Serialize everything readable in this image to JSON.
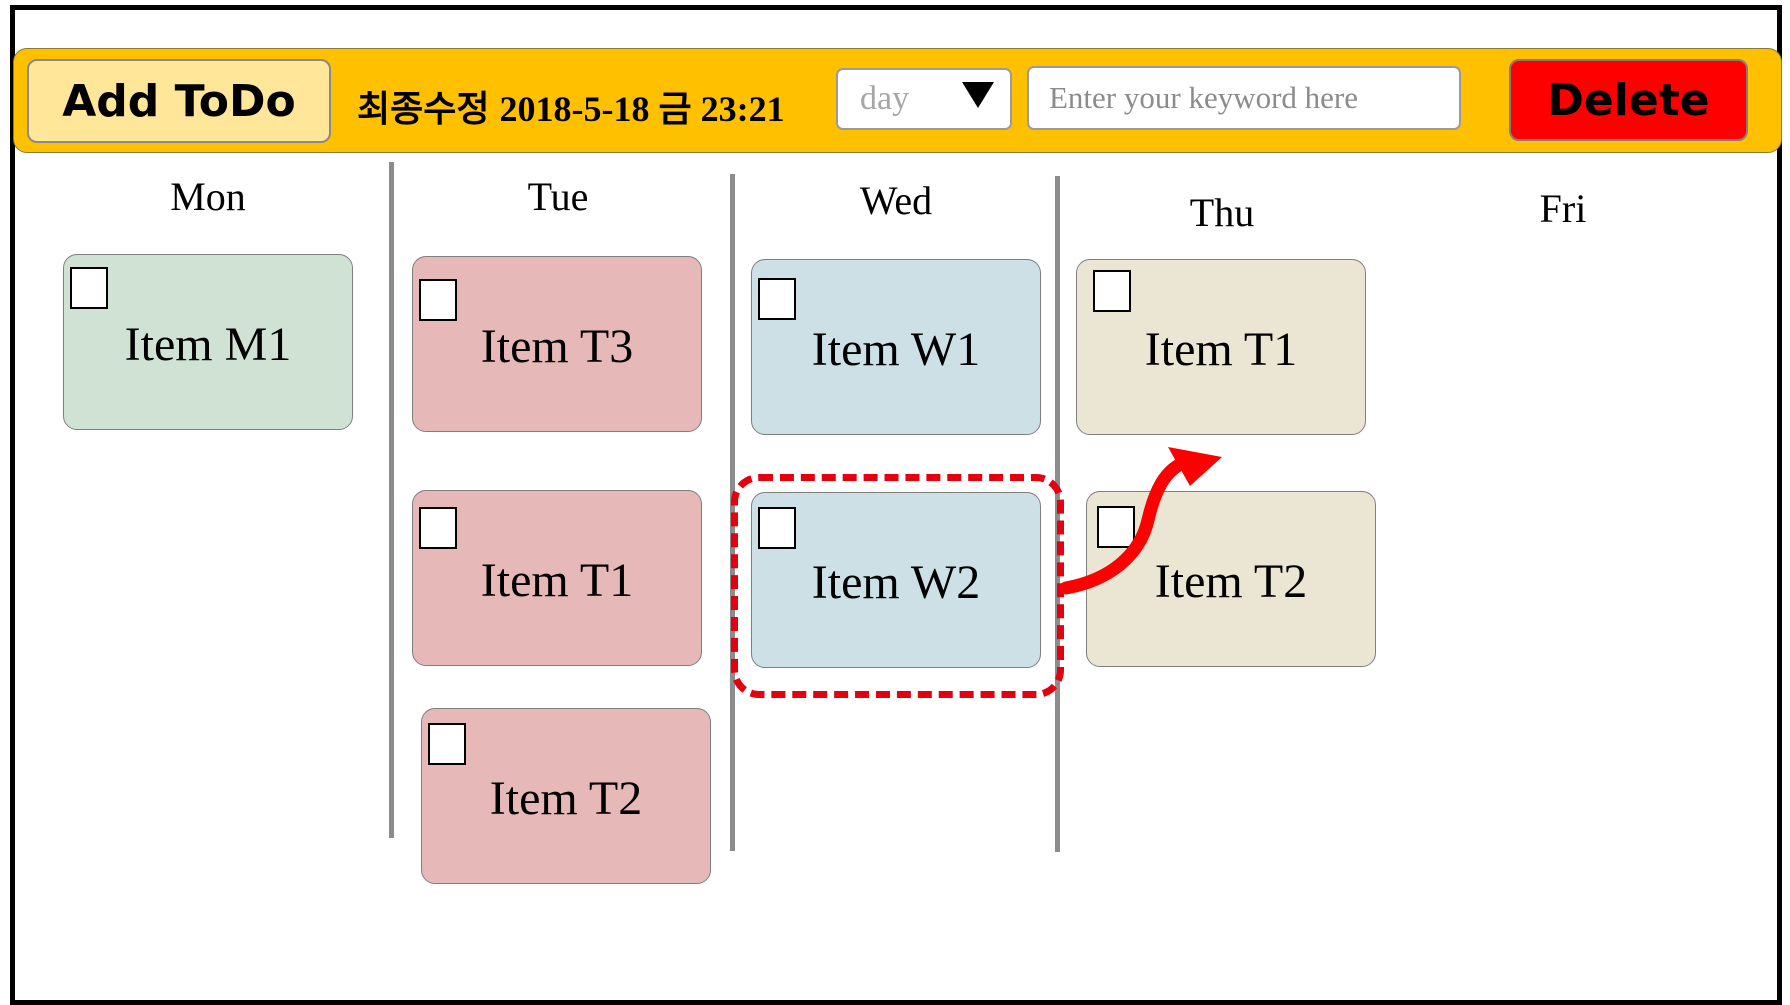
{
  "toolbar": {
    "add_label": "Add ToDo",
    "last_modified_label": "최종수정",
    "last_modified_value": "2018-5-18 금 23:21",
    "view_select_value": "day",
    "search_placeholder": "Enter your keyword here",
    "delete_label": "Delete"
  },
  "days": [
    "Mon",
    "Tue",
    "Wed",
    "Thu",
    "Fri"
  ],
  "cards": {
    "mon": [
      {
        "title": "Item M1"
      }
    ],
    "tue": [
      {
        "title": "Item T3"
      },
      {
        "title": "Item T1"
      },
      {
        "title": "Item T2"
      }
    ],
    "wed": [
      {
        "title": "Item W1"
      },
      {
        "title": "Item W2"
      }
    ],
    "thu": [
      {
        "title": "Item T1"
      },
      {
        "title": "Item T2"
      }
    ]
  },
  "colors": {
    "toolbar": "#ffc000",
    "add_button": "#ffe699",
    "delete_button": "#ff0000",
    "mon_card": "#d0e2d4",
    "tue_card": "#e6b8b8",
    "wed_card": "#cce0e6",
    "thu_card": "#ebe6d4",
    "annotation": "#e3000f"
  }
}
